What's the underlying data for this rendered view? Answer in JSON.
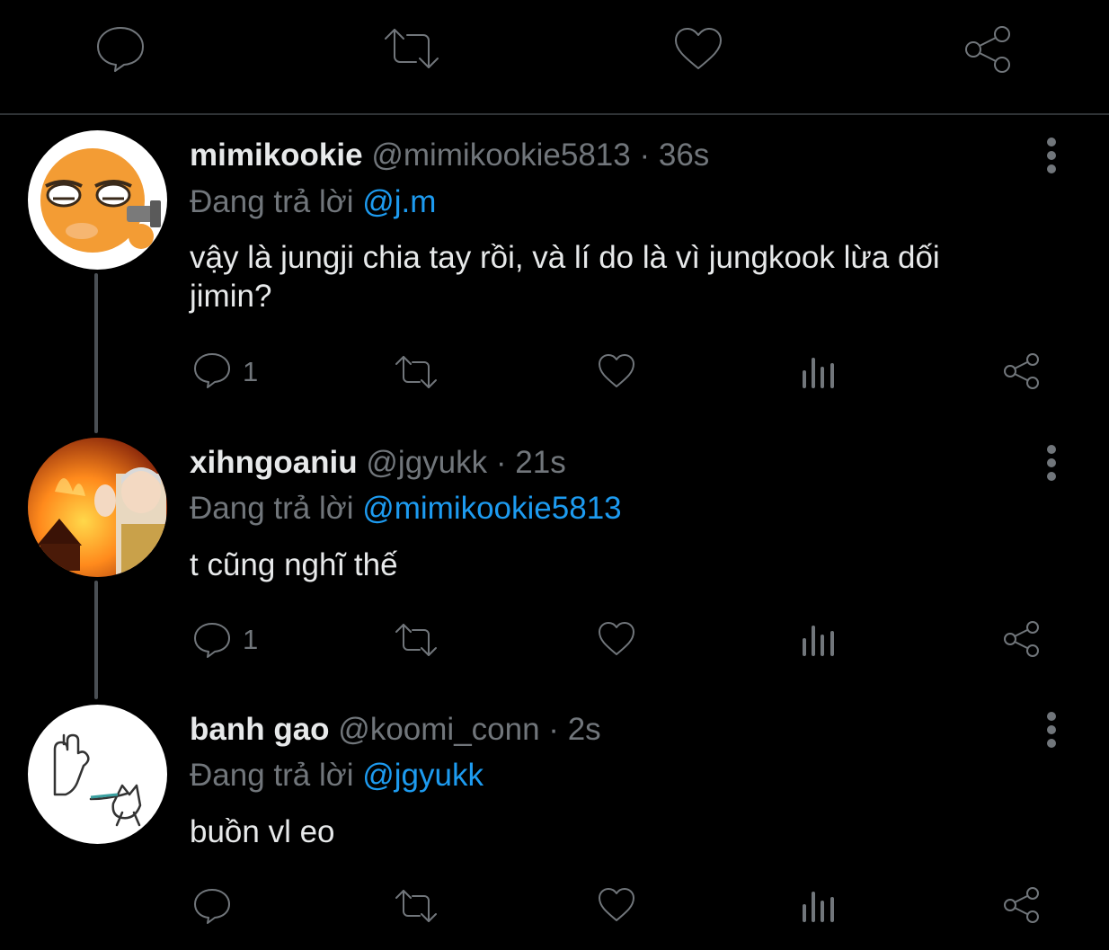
{
  "top_actions": [
    "reply",
    "retweet",
    "like",
    "share"
  ],
  "tweets": [
    {
      "name": "mimikookie",
      "handle": "@mimikookie5813",
      "time": "36s",
      "reply_prefix": "Đang trả lời",
      "reply_to": "@j.m",
      "text": "vậy là jungji chia tay rồi, và lí do là vì jungkook lừa dối jimin?",
      "reply_count": "1"
    },
    {
      "name": "xihngoaniu",
      "handle": "@jgyukk",
      "time": "21s",
      "reply_prefix": "Đang trả lời",
      "reply_to": "@mimikookie5813",
      "text": "t cũng nghĩ thế",
      "reply_count": "1"
    },
    {
      "name": "banh gao",
      "handle": "@koomi_conn",
      "time": "2s",
      "reply_prefix": "Đang trả lời",
      "reply_to": "@jgyukk",
      "text": "buồn vl eo",
      "reply_count": ""
    }
  ],
  "colors": {
    "accent": "#1d9bf0",
    "muted": "#71767b",
    "text": "#e7e9ea",
    "background": "#000000"
  }
}
